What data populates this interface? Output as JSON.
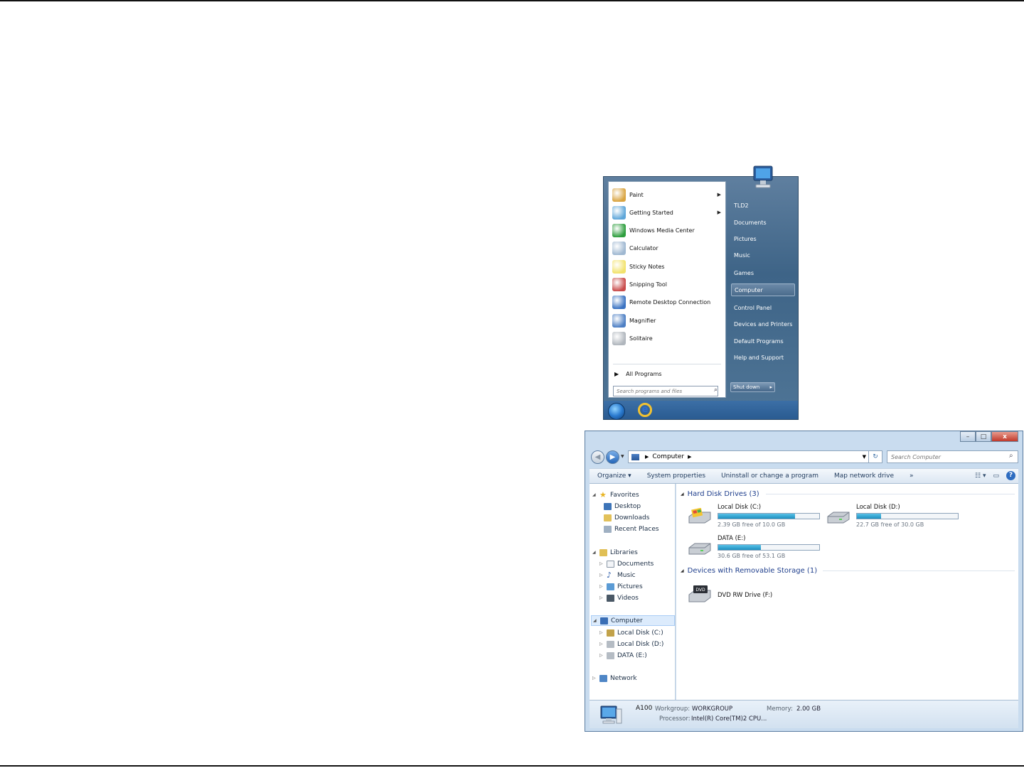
{
  "start_menu": {
    "programs": [
      {
        "label": "Paint",
        "has_submenu": true,
        "icon": "paint-icon",
        "color": "#d9a441"
      },
      {
        "label": "Getting Started",
        "has_submenu": true,
        "icon": "getting-started-icon",
        "color": "#5ea6d9"
      },
      {
        "label": "Windows Media Center",
        "has_submenu": false,
        "icon": "media-center-icon",
        "color": "#2e9e3e"
      },
      {
        "label": "Calculator",
        "has_submenu": false,
        "icon": "calculator-icon",
        "color": "#9fb8d1"
      },
      {
        "label": "Sticky Notes",
        "has_submenu": false,
        "icon": "sticky-notes-icon",
        "color": "#f2e26b"
      },
      {
        "label": "Snipping Tool",
        "has_submenu": false,
        "icon": "snipping-tool-icon",
        "color": "#c94b4b"
      },
      {
        "label": "Remote Desktop Connection",
        "has_submenu": false,
        "icon": "remote-desktop-icon",
        "color": "#3b73c2"
      },
      {
        "label": "Magnifier",
        "has_submenu": false,
        "icon": "magnifier-icon",
        "color": "#4d7fc4"
      },
      {
        "label": "Solitaire",
        "has_submenu": false,
        "icon": "solitaire-icon",
        "color": "#b0b6bd"
      }
    ],
    "all_programs": "All Programs",
    "search_placeholder": "Search programs and files",
    "right_items": [
      "TLD2",
      "Documents",
      "Pictures",
      "Music",
      "Games",
      "Computer",
      "Control Panel",
      "Devices and Printers",
      "Default Programs",
      "Help and Support"
    ],
    "highlighted": "Computer",
    "shutdown_label": "Shut down"
  },
  "explorer": {
    "breadcrumb": "Computer",
    "search_placeholder": "Search Computer",
    "commands": [
      "Organize ▾",
      "System properties",
      "Uninstall or change a program",
      "Map network drive",
      "»"
    ],
    "nav": {
      "favorites": "Favorites",
      "favorite_items": [
        "Desktop",
        "Downloads",
        "Recent Places"
      ],
      "libraries": "Libraries",
      "library_items": [
        "Documents",
        "Music",
        "Pictures",
        "Videos"
      ],
      "computer": "Computer",
      "computer_items": [
        "Local Disk (C:)",
        "Local Disk (D:)",
        "DATA (E:)"
      ],
      "network": "Network"
    },
    "hard_disk_group": "Hard Disk Drives (3)",
    "drives": [
      {
        "name": "Local Disk (C:)",
        "free_text": "2.39 GB free of 10.0 GB",
        "used_fraction": 0.76
      },
      {
        "name": "Local Disk (D:)",
        "free_text": "22.7 GB free of 30.0 GB",
        "used_fraction": 0.24
      },
      {
        "name": "DATA (E:)",
        "free_text": "30.6 GB free of 53.1 GB",
        "used_fraction": 0.42
      }
    ],
    "removable_group": "Devices with Removable Storage (1)",
    "dvd": {
      "name": "DVD RW Drive (F:)",
      "badge": "DVD"
    },
    "details": {
      "computer_name": "A100",
      "workgroup_label": "Workgroup:",
      "workgroup": "WORKGROUP",
      "memory_label": "Memory:",
      "memory": "2.00 GB",
      "processor_label": "Processor:",
      "processor": "Intel(R) Core(TM)2 CPU..."
    }
  }
}
